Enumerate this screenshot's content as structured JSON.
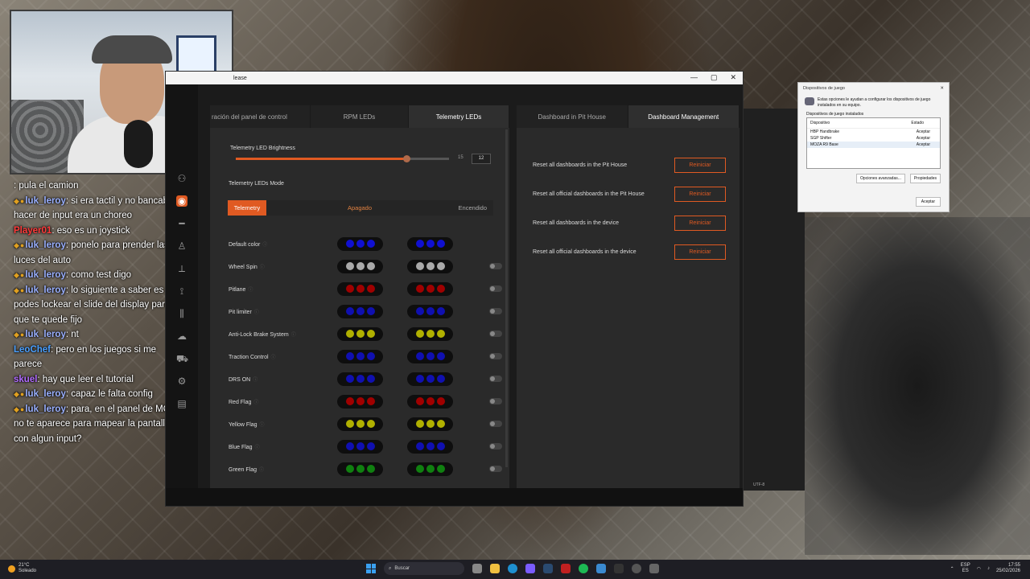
{
  "webcam": {},
  "chat": [
    {
      "user": "",
      "msg": ": pula el camion",
      "color": "#4aa0ff"
    },
    {
      "user": "luk_leroy",
      "msg": ": si era tactil y no bancaba hacer de input era un choreo",
      "color": "#9ab0ff",
      "badges": "◆●"
    },
    {
      "user": "Player01",
      "msg": ": eso es un joystick",
      "color": "#ff3a3a"
    },
    {
      "user": "luk_leroy",
      "msg": ": ponelo para prender las luces del auto",
      "color": "#9ab0ff",
      "badges": "◆●"
    },
    {
      "user": "luk_leroy",
      "msg": ": como test digo",
      "color": "#9ab0ff",
      "badges": "◆●"
    },
    {
      "user": "luk_leroy",
      "msg": ": lo siguiente a saber es si podes lockear el slide del display para que te quede fijo",
      "color": "#9ab0ff",
      "badges": "◆●"
    },
    {
      "user": "luk_leroy",
      "msg": ": nt",
      "color": "#9ab0ff",
      "badges": "◆●"
    },
    {
      "user": "LeoChef",
      "msg": ": pero en los juegos si me parece",
      "color": "#4aa0ff"
    },
    {
      "user": "skuel",
      "msg": ": hay que leer el tutorial",
      "color": "#b06aff"
    },
    {
      "user": "luk_leroy",
      "msg": ": capaz le falta config",
      "color": "#9ab0ff",
      "badges": "◆●"
    },
    {
      "user": "luk_leroy",
      "msg": ": para, en el panel de MOZA no te aparece para mapear la pantallita con algun input?",
      "color": "#9ab0ff",
      "badges": "◆●"
    }
  ],
  "app": {
    "title": "lease",
    "controls": {
      "min": "—",
      "max": "▢",
      "close": "✕"
    },
    "sidebar_icons": [
      "users-icon",
      "dashboard-icon",
      "wheel-icon",
      "pedal-icon",
      "shifter-icon",
      "handbrake-icon",
      "library-icon",
      "cloud-icon",
      "car-icon",
      "gear-icon",
      "manual-icon"
    ],
    "tabs_left": [
      "ración del panel de control",
      "RPM LEDs",
      "Telemetry LEDs"
    ],
    "tabs_right": [
      "Dashboard in Pit House",
      "Dashboard Management"
    ],
    "brightness": {
      "label": "Telemetry LED Brightness",
      "value": 12,
      "max": 15
    },
    "mode": {
      "label": "Telemetry LEDs Mode",
      "options": [
        "Telemetry",
        "Apagado",
        "Encendido"
      ],
      "selected": "Telemetry"
    },
    "led_rows": [
      {
        "label": "Default color",
        "color": "#1010d0",
        "toggle": false,
        "has_toggle": false
      },
      {
        "label": "Wheel Spin",
        "color": "#a8a8a8",
        "has_toggle": true
      },
      {
        "label": "Pitlane",
        "color": "#a00000",
        "has_toggle": true
      },
      {
        "label": "Pit limiter",
        "color": "#1010b0",
        "has_toggle": true
      },
      {
        "label": "Anti-Lock Brake System",
        "color": "#b0b000",
        "has_toggle": true
      },
      {
        "label": "Traction Control",
        "color": "#1010b0",
        "has_toggle": true
      },
      {
        "label": "DRS ON",
        "color": "#1010b0",
        "has_toggle": true
      },
      {
        "label": "Red Flag",
        "color": "#a00000",
        "has_toggle": true
      },
      {
        "label": "Yellow Flag",
        "color": "#b0b000",
        "has_toggle": true
      },
      {
        "label": "Blue Flag",
        "color": "#1010b0",
        "has_toggle": true
      },
      {
        "label": "Green Flag",
        "color": "#108010",
        "has_toggle": true
      }
    ],
    "reset_rows": [
      {
        "label": "Reset all dashboards in the Pit House",
        "button": "Reiniciar"
      },
      {
        "label": "Reset all official dashboards in the Pit House",
        "button": "Reiniciar"
      },
      {
        "label": "Reset all dashboards in the device",
        "button": "Reiniciar"
      },
      {
        "label": "Reset all official dashboards in the device",
        "button": "Reiniciar"
      }
    ]
  },
  "bg_app": {
    "encoding": "UTF-8"
  },
  "dialog": {
    "title": "Dispositivos de juego",
    "description": "Estas opciones le ayudan a configurar los dispositivos de juego instalados en su equipo.",
    "subtitle": "Dispositivos de juego instalados",
    "col_device": "Dispositivo",
    "col_status": "Estado",
    "devices": [
      {
        "name": "HBP Handbrake",
        "status": "Aceptar"
      },
      {
        "name": "SGP Shifter",
        "status": "Aceptar"
      },
      {
        "name": "MOZA R9 Base",
        "status": "Aceptar"
      }
    ],
    "btn_advanced": "Opciones avanzadas...",
    "btn_properties": "Propiedades",
    "btn_ok": "Aceptar"
  },
  "taskbar": {
    "temp": "21°C",
    "weather": "Soleado",
    "search": "Buscar",
    "lang1": "ESP",
    "lang2": "ES",
    "time": "17:55",
    "date": "25/02/2026"
  }
}
